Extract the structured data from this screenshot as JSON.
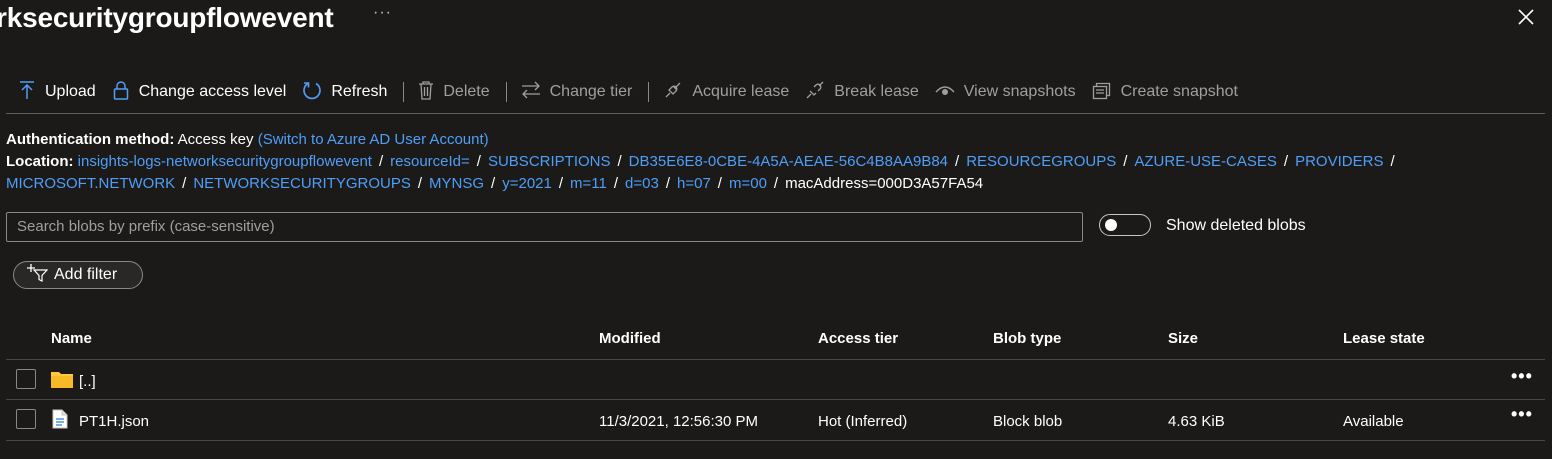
{
  "header": {
    "title": "rksecuritygroupflowevent",
    "more": "···"
  },
  "toolbar": [
    {
      "label": "Upload",
      "icon": "upload-icon",
      "enabled": true
    },
    {
      "label": "Change access level",
      "icon": "lock-icon",
      "enabled": true
    },
    {
      "label": "Refresh",
      "icon": "refresh-icon",
      "enabled": true
    },
    {
      "label": "Delete",
      "icon": "trash-icon",
      "enabled": false
    },
    {
      "label": "Change tier",
      "icon": "swap-icon",
      "enabled": false
    },
    {
      "label": "Acquire lease",
      "icon": "link-icon",
      "enabled": false
    },
    {
      "label": "Break lease",
      "icon": "broken-link-icon",
      "enabled": false
    },
    {
      "label": "View snapshots",
      "icon": "eye-icon",
      "enabled": false
    },
    {
      "label": "Create snapshot",
      "icon": "snapshot-icon",
      "enabled": false
    }
  ],
  "auth": {
    "label": "Authentication method:",
    "value": "Access key",
    "switch_link": "(Switch to Azure AD User Account)"
  },
  "location": {
    "label": "Location:",
    "segments": [
      "insights-logs-networksecuritygroupflowevent",
      "resourceId=",
      "SUBSCRIPTIONS",
      "DB35E6E8-0CBE-4A5A-AEAE-56C4B8AA9B84",
      "RESOURCEGROUPS",
      "AZURE-USE-CASES",
      "PROVIDERS",
      "MICROSOFT.NETWORK",
      "NETWORKSECURITYGROUPS",
      "MYNSG",
      "y=2021",
      "m=11",
      "d=03",
      "h=07",
      "m=00",
      "macAddress=000D3A57FA54"
    ],
    "separator": "/"
  },
  "search": {
    "placeholder": "Search blobs by prefix (case-sensitive)",
    "value": ""
  },
  "show_deleted": {
    "label": "Show deleted blobs",
    "on": false
  },
  "add_filter": {
    "label": "Add filter"
  },
  "table": {
    "columns": [
      "Name",
      "Modified",
      "Access tier",
      "Blob type",
      "Size",
      "Lease state"
    ],
    "rows": [
      {
        "name": "[..]",
        "type": "folder",
        "modified": "",
        "tier": "",
        "blob_type": "",
        "size": "",
        "lease": "",
        "more": "•••"
      },
      {
        "name": "PT1H.json",
        "type": "file",
        "modified": "11/3/2021, 12:56:30 PM",
        "tier": "Hot (Inferred)",
        "blob_type": "Block blob",
        "size": "4.63 KiB",
        "lease": "Available",
        "more": "•••"
      }
    ]
  },
  "colors": {
    "background": "#1b1a19",
    "link": "#4f9ef7",
    "folder": "#ffc83d",
    "accent": "#4f9ef7"
  }
}
